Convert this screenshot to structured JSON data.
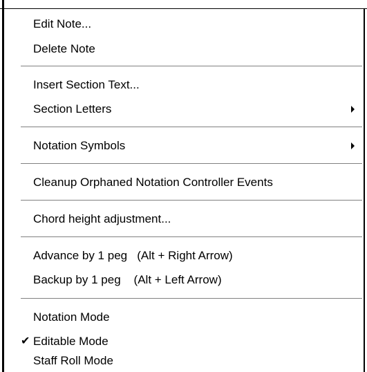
{
  "menu": {
    "items": [
      {
        "label": "Edit Note..."
      },
      {
        "label": "Delete Note"
      },
      {
        "label": "Insert Section Text..."
      },
      {
        "label": "Section Letters",
        "has_submenu": true
      },
      {
        "label": "Notation Symbols",
        "has_submenu": true
      },
      {
        "label": "Cleanup Orphaned Notation Controller Events"
      },
      {
        "label": "Chord height adjustment..."
      },
      {
        "label": "Advance by 1 peg   (Alt + Right Arrow)"
      },
      {
        "label": "Backup by 1 peg    (Alt + Left Arrow)"
      },
      {
        "label": "Notation Mode"
      },
      {
        "label": "Editable Mode",
        "checked": true
      },
      {
        "label": "Staff Roll Mode"
      }
    ],
    "check_glyph": "✔",
    "submenu_icon": "submenu-arrow-icon"
  },
  "colors": {
    "background": "#ffffff",
    "text": "#000000",
    "separator": "#808080",
    "border": "#000000"
  }
}
